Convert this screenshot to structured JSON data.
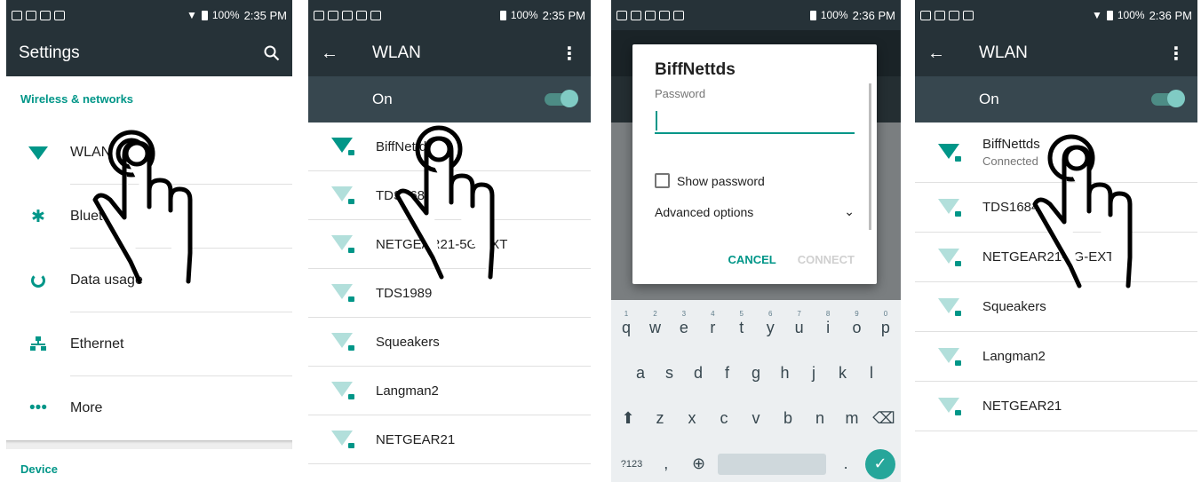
{
  "status": {
    "battery": "100%",
    "time_a": "2:35 PM",
    "time_b": "2:36 PM"
  },
  "settings": {
    "title": "Settings",
    "search_icon": "search-icon",
    "section_wireless": "Wireless & networks",
    "items": [
      {
        "label": "WLAN",
        "icon": "wifi-icon"
      },
      {
        "label": "Bluetooth",
        "icon": "bluetooth-icon"
      },
      {
        "label": "Data usage",
        "icon": "data-usage-icon"
      },
      {
        "label": "Ethernet",
        "icon": "ethernet-icon"
      },
      {
        "label": "More",
        "icon": "more-icon"
      }
    ],
    "section_device": "Device"
  },
  "wlan": {
    "title": "WLAN",
    "switch_label": "On",
    "networks": [
      "BiffNettds",
      "TDS1684",
      "NETGEAR21-5G-EXT",
      "TDS1989",
      "Squeakers",
      "Langman2",
      "NETGEAR21"
    ]
  },
  "dialog": {
    "title": "BiffNettds",
    "password_label": "Password",
    "show_password": "Show password",
    "advanced": "Advanced options",
    "cancel": "CANCEL",
    "connect": "CONNECT"
  },
  "keyboard": {
    "row1": [
      "q",
      "w",
      "e",
      "r",
      "t",
      "y",
      "u",
      "i",
      "o",
      "p"
    ],
    "row1_nums": [
      "1",
      "2",
      "3",
      "4",
      "5",
      "6",
      "7",
      "8",
      "9",
      "0"
    ],
    "row2": [
      "a",
      "s",
      "d",
      "f",
      "g",
      "h",
      "j",
      "k",
      "l"
    ],
    "row3": [
      "z",
      "x",
      "c",
      "v",
      "b",
      "n",
      "m"
    ],
    "symbols": "?123",
    "comma": ",",
    "period": "."
  },
  "wlan_connected": {
    "title": "WLAN",
    "switch_label": "On",
    "networks": [
      {
        "name": "BiffNettds",
        "status": "Connected"
      },
      {
        "name": "TDS1684",
        "status": ""
      },
      {
        "name": "NETGEAR21-5G-EXT",
        "status": ""
      },
      {
        "name": "Squeakers",
        "status": ""
      },
      {
        "name": "Langman2",
        "status": ""
      },
      {
        "name": "NETGEAR21",
        "status": ""
      }
    ]
  }
}
